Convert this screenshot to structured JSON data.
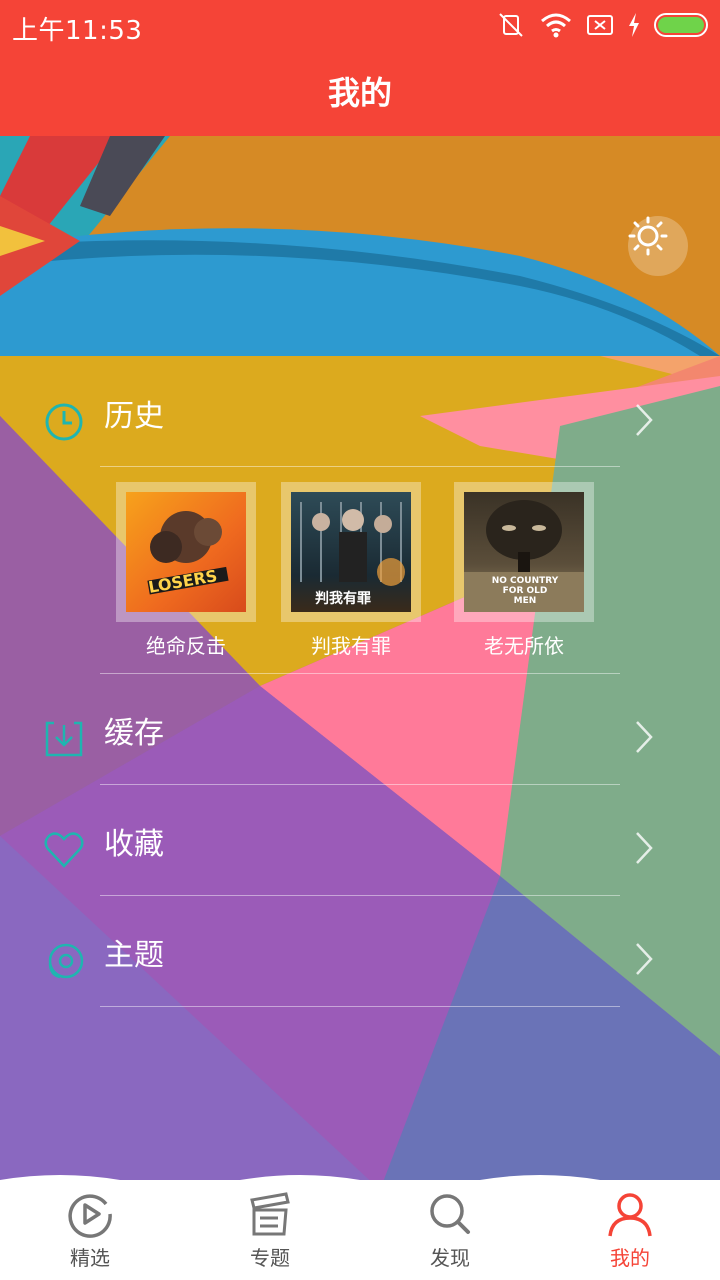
{
  "status_bar": {
    "time": "上午11:53",
    "icons": [
      "mute-icon",
      "wifi-icon",
      "sim-icon",
      "charging-icon",
      "battery-icon"
    ]
  },
  "header": {
    "title": "我的"
  },
  "banner": {
    "settings_icon": "sun-settings-icon"
  },
  "menu": {
    "history": {
      "label": "历史",
      "icon": "clock-icon"
    },
    "history_items": [
      {
        "title": "绝命反击",
        "poster_text": "LOSERS"
      },
      {
        "title": "判我有罪",
        "poster_text": "判我有罪"
      },
      {
        "title": "老无所依",
        "poster_text": "NO COUNTRY FOR OLD MEN"
      }
    ],
    "cache": {
      "label": "缓存",
      "icon": "download-icon"
    },
    "favorites": {
      "label": "收藏",
      "icon": "heart-icon"
    },
    "theme": {
      "label": "主题",
      "icon": "theme-icon"
    }
  },
  "bottom_nav": [
    {
      "label": "精选",
      "icon": "play-circle-icon",
      "active": false
    },
    {
      "label": "专题",
      "icon": "clapperboard-icon",
      "active": false
    },
    {
      "label": "发现",
      "icon": "search-icon",
      "active": false
    },
    {
      "label": "我的",
      "icon": "user-icon",
      "active": true
    }
  ],
  "colors": {
    "accent": "#f54437",
    "icon_teal": "#1fb5b0",
    "nav_gray": "#777777"
  }
}
